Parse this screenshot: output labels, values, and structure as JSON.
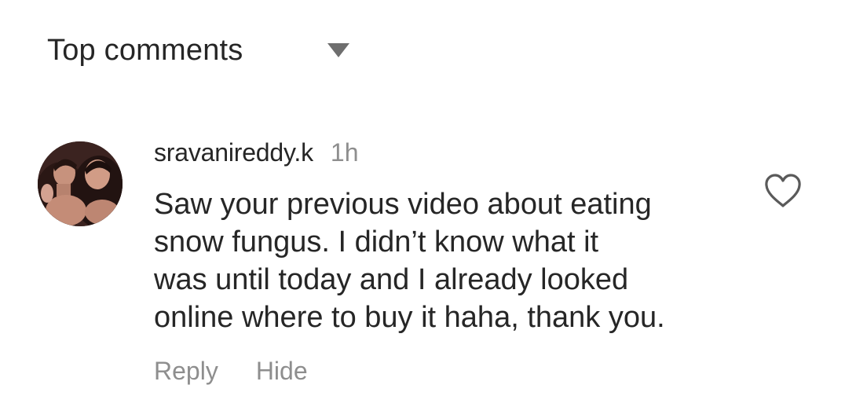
{
  "comments_header": {
    "sort_label": "Top comments",
    "caret_icon": "triangle-down-icon"
  },
  "comment": {
    "username": "sravanireddy.k",
    "time": "1h",
    "text_lines": [
      "Saw your previous video about eating",
      "snow fungus. I didn’t know what it",
      "was until today and I already looked",
      "online where to buy it haha, thank you."
    ],
    "actions": {
      "reply": "Reply",
      "hide": "Hide"
    },
    "like_icon": "heart-outline-icon"
  },
  "colors": {
    "text_primary": "#262626",
    "text_secondary": "#8e8e8e",
    "caret": "#6e6e6e",
    "background": "#ffffff"
  }
}
